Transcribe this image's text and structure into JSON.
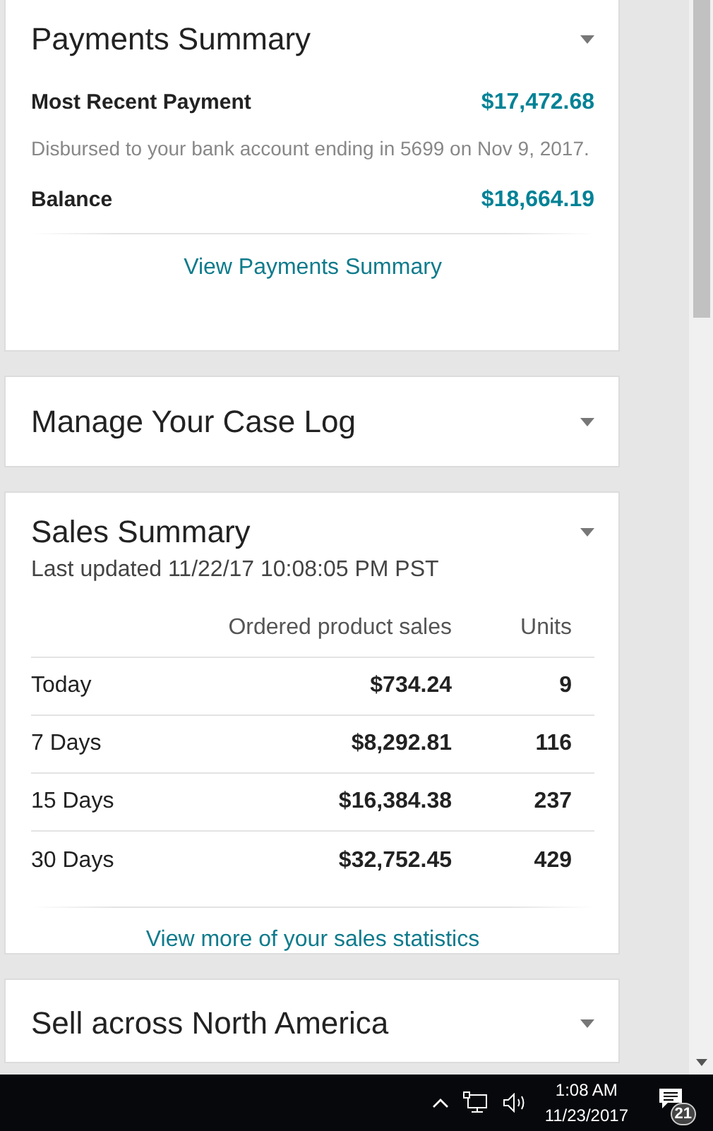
{
  "payments": {
    "title": "Payments Summary",
    "recent": {
      "label": "Most Recent Payment",
      "amount": "$17,472.68",
      "note": "Disbursed to your bank account ending in 5699 on Nov 9, 2017."
    },
    "balance": {
      "label": "Balance",
      "amount": "$18,664.19"
    },
    "link": "View Payments Summary"
  },
  "case_log": {
    "title": "Manage Your Case Log"
  },
  "sales": {
    "title": "Sales Summary",
    "updated": "Last updated 11/22/17 10:08:05 PM PST",
    "columns": [
      "Ordered product sales",
      "Units"
    ],
    "rows": [
      {
        "period": "Today",
        "sales": "$734.24",
        "units": "9"
      },
      {
        "period": "7 Days",
        "sales": "$8,292.81",
        "units": "116"
      },
      {
        "period": "15 Days",
        "sales": "$16,384.38",
        "units": "237"
      },
      {
        "period": "30 Days",
        "sales": "$32,752.45",
        "units": "429"
      }
    ],
    "link": "View more of your sales statistics"
  },
  "sell": {
    "title": "Sell across North America"
  },
  "taskbar": {
    "time": "1:08 AM",
    "date": "11/23/2017",
    "notifications": "21"
  }
}
